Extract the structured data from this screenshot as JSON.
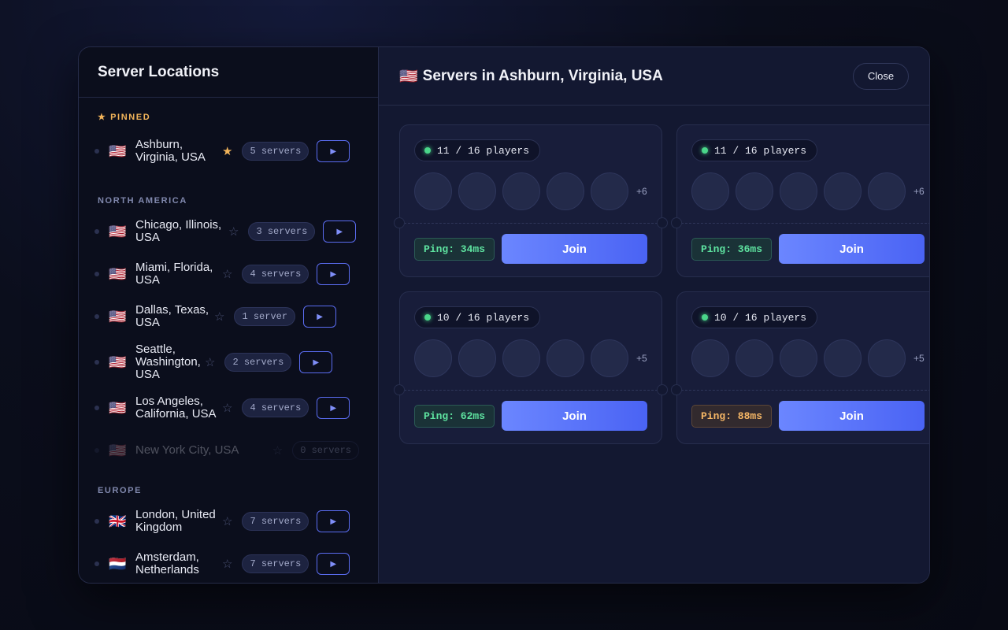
{
  "sidebar": {
    "title": "Server Locations",
    "pinned_label": "★ PINNED",
    "pinned": [
      {
        "flag": "🇺🇸",
        "name": "Ashburn, Virginia, USA",
        "servers": "5 servers",
        "starred": true
      }
    ],
    "north_america_label": "NORTH AMERICA",
    "north_america": [
      {
        "flag": "🇺🇸",
        "name": "Chicago, Illinois, USA",
        "servers": "3 servers"
      },
      {
        "flag": "🇺🇸",
        "name": "Miami, Florida, USA",
        "servers": "4 servers"
      },
      {
        "flag": "🇺🇸",
        "name": "Dallas, Texas, USA",
        "servers": "1 server"
      },
      {
        "flag": "🇺🇸",
        "name": "Seattle, Washington, USA",
        "servers": "2 servers"
      },
      {
        "flag": "🇺🇸",
        "name": "Los Angeles, California, USA",
        "servers": "4 servers"
      },
      {
        "flag": "🇺🇸",
        "name": "New York City, USA",
        "servers": "0 servers",
        "disabled": true
      }
    ],
    "europe_label": "EUROPE",
    "europe": [
      {
        "flag": "🇬🇧",
        "name": "London, United Kingdom",
        "servers": "7 servers"
      },
      {
        "flag": "🇳🇱",
        "name": "Amsterdam, Netherlands",
        "servers": "7 servers"
      }
    ],
    "play_glyph": "▶",
    "star_on": "★",
    "star_off": "☆"
  },
  "main": {
    "title_flag": "🇺🇸",
    "title": "Servers in Ashburn, Virginia, USA",
    "close_label": "Close",
    "servers": [
      {
        "players": "11 / 16 players",
        "more": "+6",
        "ping": "Ping: 34ms",
        "ping_status": "good",
        "join_label": "Join"
      },
      {
        "players": "11 / 16 players",
        "more": "+6",
        "ping": "Ping: 36ms",
        "ping_status": "good",
        "join_label": "Join"
      },
      {
        "players": "10 / 16 players",
        "more": "+5",
        "ping": "Ping: 62ms",
        "ping_status": "good",
        "join_label": "Join"
      },
      {
        "players": "10 / 16 players",
        "more": "+5",
        "ping": "Ping: 88ms",
        "ping_status": "warn",
        "join_label": "Join"
      }
    ]
  },
  "colors": {
    "accent": "#5a6cf0",
    "pinned": "#f2b45a",
    "ping_good": "#5ee3a0",
    "ping_warn": "#f6b766",
    "online": "#4ad68a"
  }
}
